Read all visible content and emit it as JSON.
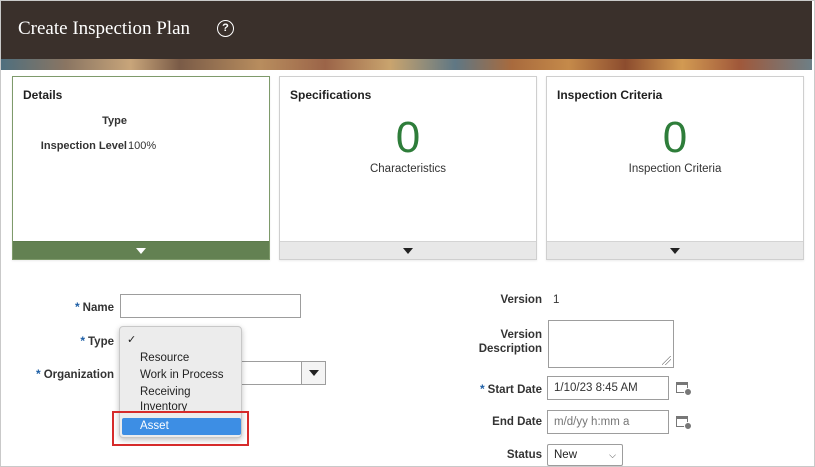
{
  "header": {
    "title": "Create Inspection Plan",
    "help_glyph": "?"
  },
  "cards": [
    {
      "title": "Details",
      "rows": [
        {
          "label": "Type",
          "value": ""
        },
        {
          "label": "Inspection Level",
          "value": "100%"
        }
      ]
    },
    {
      "title": "Specifications",
      "count": "0",
      "caption": "Characteristics"
    },
    {
      "title": "Inspection Criteria",
      "count": "0",
      "caption": "Inspection Criteria"
    }
  ],
  "form": {
    "required_marker": "*",
    "name": {
      "label": "Name",
      "value": ""
    },
    "type": {
      "label": "Type"
    },
    "organization": {
      "label": "Organization",
      "value": ""
    },
    "version": {
      "label": "Version",
      "value": "1"
    },
    "version_description": {
      "label_line1": "Version",
      "label_line2": "Description",
      "value": ""
    },
    "start_date": {
      "label": "Start Date",
      "value": "1/10/23 8:45 AM"
    },
    "end_date": {
      "label": "End Date",
      "placeholder": "m/d/yy h:mm a"
    },
    "status": {
      "label": "Status",
      "value": "New"
    }
  },
  "type_dropdown": {
    "checkmark": "✓",
    "options": [
      "Resource",
      "Work in Process",
      "Receiving",
      "Inventory",
      "Asset"
    ],
    "highlighted": "Asset"
  },
  "icons": {
    "help": "help-circle-icon",
    "collapse": "triangle-down-icon",
    "calendar": "calendar-clock-icon",
    "select": "chevron-down-icon"
  },
  "colors": {
    "header_bg": "#3a302b",
    "metric_green": "#2e7d3a",
    "selected_card_footer": "#638152",
    "highlight": "#3d8ee4",
    "callout_red": "#d62b2b"
  }
}
